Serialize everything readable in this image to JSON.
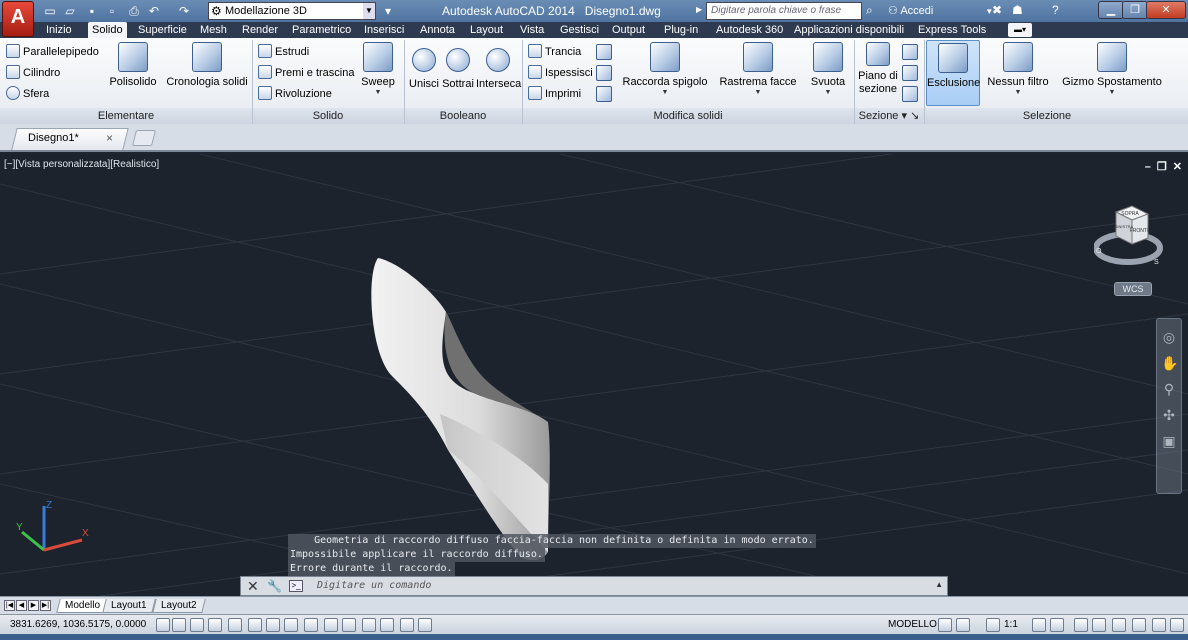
{
  "titlebar": {
    "app_letter": "A",
    "workspace": "Modellazione 3D",
    "app_title": "Autodesk AutoCAD 2014",
    "document_name": "Disegno1.dwg",
    "search_placeholder": "Digitare parola chiave o frase",
    "sign_in": "Accedi",
    "help": "?"
  },
  "ribbon_tabs": [
    {
      "label": "Inizio"
    },
    {
      "label": "Solido",
      "active": true
    },
    {
      "label": "Superficie"
    },
    {
      "label": "Mesh"
    },
    {
      "label": "Render"
    },
    {
      "label": "Parametrico"
    },
    {
      "label": "Inserisci"
    },
    {
      "label": "Annota"
    },
    {
      "label": "Layout"
    },
    {
      "label": "Vista"
    },
    {
      "label": "Gestisci"
    },
    {
      "label": "Output"
    },
    {
      "label": "Plug-in"
    },
    {
      "label": "Autodesk 360"
    },
    {
      "label": "Applicazioni disponibili"
    },
    {
      "label": "Express Tools"
    }
  ],
  "panels": {
    "elementare": {
      "title": "Elementare",
      "parallelepipedo": "Parallelepipedo",
      "cilindro": "Cilindro",
      "sfera": "Sfera",
      "polisolido": "Polisolido",
      "cronologia": "Cronologia solidi"
    },
    "solido": {
      "title": "Solido",
      "estrudi": "Estrudi",
      "premi": "Premi e trascina",
      "rivoluzione": "Rivoluzione",
      "sweep": "Sweep"
    },
    "booleano": {
      "title": "Booleano",
      "unisci": "Unisci",
      "sottrai": "Sottrai",
      "interseca": "Interseca"
    },
    "modifica": {
      "title": "Modifica solidi",
      "trancia": "Trancia",
      "ispessisci": "Ispessisci",
      "imprimi": "Imprimi",
      "raccorda": "Raccorda spigolo",
      "rastrema": "Rastrema facce",
      "svuota": "Svuota"
    },
    "sezione": {
      "title": "Sezione",
      "piano_1": "Piano di",
      "piano_2": "sezione"
    },
    "selezione": {
      "title": "Selezione",
      "esclusione": "Esclusione",
      "nessun_filtro": "Nessun filtro",
      "gizmo": "Gizmo Spostamento"
    }
  },
  "doc_tab": {
    "label": "Disegno1*"
  },
  "viewport": {
    "label": "[−][Vista personalizzata][Realistico]",
    "wcs": "WCS",
    "viewcube_top": "SOPRA",
    "viewcube_front": "FRONTE",
    "viewcube_left": "SINISTRA",
    "compass": {
      "w": "O",
      "s": "S"
    },
    "axes": {
      "x": "X",
      "y": "Y",
      "z": "Z"
    }
  },
  "command": {
    "history": [
      "    Geometria di raccordo diffuso faccia-faccia non definita o definita in modo errato.",
      "Impossibile applicare il raccordo diffuso.",
      "Errore durante il raccordo."
    ],
    "placeholder": "Digitare un comando"
  },
  "layout_tabs": [
    {
      "label": "Modello",
      "active": true
    },
    {
      "label": "Layout1"
    },
    {
      "label": "Layout2"
    }
  ],
  "status": {
    "coords": "3831.6269, 1036.5175, 0.0000",
    "model": "MODELLO",
    "scale": "1:1"
  },
  "colors": {
    "viewport_bg": "#1d232d",
    "ribbon_tabs_bg": "#2d3a4f",
    "title_bg": "#5a7fab",
    "selected_btn": "#a8cdf4",
    "axis_x": "#d94a3a",
    "axis_y": "#3fc04a",
    "axis_z": "#3a7ad9"
  }
}
